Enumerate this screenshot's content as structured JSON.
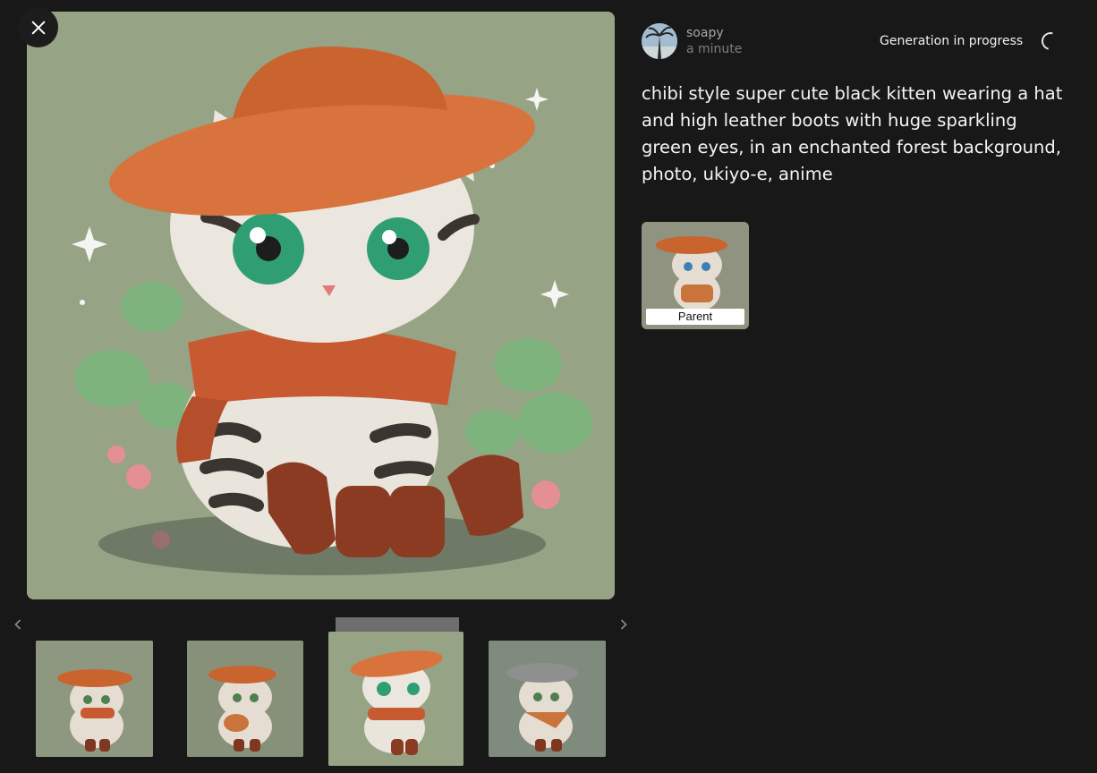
{
  "close_icon": "close-icon",
  "author": {
    "name": "soapy",
    "time": "a minute"
  },
  "status": {
    "text": "Generation in progress",
    "icon": "spinner-icon"
  },
  "prompt": "chibi style super cute black kitten wearing a hat and high leather boots with huge sparkling green eyes, in an enchanted forest background, photo, ukiyo-e, anime",
  "parent": {
    "label": "Parent"
  },
  "carousel": {
    "prev_icon": "chevron-left-icon",
    "next_icon": "chevron-right-icon",
    "selected_index": 2
  },
  "colors": {
    "background": "#181818",
    "image_bg": "#96a385",
    "hat": "#d8733e",
    "scarf": "#c85a32",
    "boots": "#8a3b22",
    "eyes": "#2fa877"
  }
}
